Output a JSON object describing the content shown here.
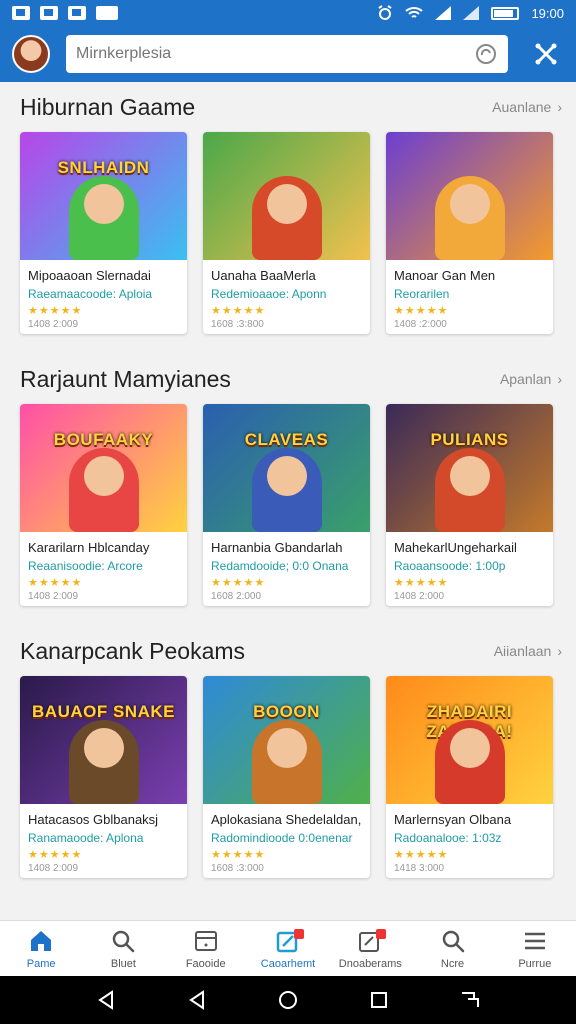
{
  "status_bar": {
    "time": "19:00"
  },
  "search": {
    "placeholder": "Mirnkerplesia"
  },
  "sections": [
    {
      "title": "Hiburnan Gaame",
      "see_all": "Auanlane",
      "cards": [
        {
          "banner": "SNLHAIDN",
          "name": "Mipoaaoan Slernadai",
          "subtitle": "Raeamaacoode: Aploia",
          "stars": "★★★★★",
          "meta": "1408 2:009",
          "bg": [
            "#b845e8",
            "#3ac0f0"
          ],
          "char": "#4bbf4b"
        },
        {
          "banner": "",
          "name": "Uanaha BaaMerla",
          "subtitle": "Redemioaaoe: Aponn",
          "stars": "★★★★★",
          "meta": "1608 :3:800",
          "bg": [
            "#4aa84a",
            "#f2c14e"
          ],
          "char": "#d64a2a"
        },
        {
          "banner": "",
          "name": "Manoar Gan Men",
          "subtitle": "Reorarilen",
          "stars": "★★★★★",
          "meta": "1408 :2:000",
          "bg": [
            "#6b3fd1",
            "#f59b2a"
          ],
          "char": "#f3a83a"
        }
      ]
    },
    {
      "title": "Rarjaunt Mamyianes",
      "see_all": "Apanlan",
      "cards": [
        {
          "banner": "BOUFAAKY",
          "name": "Kararilarn Hblcanday",
          "subtitle": "Reaanisoodie: Arcore",
          "stars": "★★★★★",
          "meta": "1408 2:009",
          "bg": [
            "#ff4fa8",
            "#ffd23f"
          ],
          "char": "#e84545"
        },
        {
          "banner": "CLAVEAS",
          "name": "Harnanbia Gbandarlah",
          "subtitle": "Redamdooide; 0:0 Onana",
          "stars": "★★★★★",
          "meta": "1608 2:000",
          "bg": [
            "#2a5fb0",
            "#3aa06a"
          ],
          "char": "#3b5bb8"
        },
        {
          "banner": "PULIANS",
          "name": "MahekarlUngeharkail",
          "subtitle": "Raoaansoode: 1:00p",
          "stars": "★★★★★",
          "meta": "1408 2:000",
          "bg": [
            "#3a2a58",
            "#c47a2a"
          ],
          "char": "#d24a2a"
        }
      ]
    },
    {
      "title": "Kanarpcank Peokams",
      "see_all": "Aiianlaan",
      "cards": [
        {
          "banner": "BAUAOF SNAKE",
          "name": "Hatacasos Gblbanaksj",
          "subtitle": "Ranamaoode: Aplona",
          "stars": "★★★★★",
          "meta": "1408 2:009",
          "bg": [
            "#2a1a4a",
            "#7a3fb0"
          ],
          "char": "#6b4a2a"
        },
        {
          "banner": "BOOON",
          "name": "Aplokasiana Shedelaldan,",
          "subtitle": "Radomindioode 0:0enenar",
          "stars": "★★★★★",
          "meta": "1608 :3:000",
          "bg": [
            "#2f8ad8",
            "#4fb04a"
          ],
          "char": "#c8742a"
        },
        {
          "banner": "ZHADAIRI ZARPIGA!",
          "name": "Marlernsyan Olbana",
          "subtitle": "Radoanalooe: 1:03z",
          "stars": "★★★★★",
          "meta": "1418 3:000",
          "bg": [
            "#ff8a1a",
            "#ffd23f"
          ],
          "char": "#d63a2a"
        }
      ]
    }
  ],
  "bottom_nav": [
    {
      "label": "Pame",
      "icon": "home-icon"
    },
    {
      "label": "Bluet",
      "icon": "search-icon"
    },
    {
      "label": "Faooide",
      "icon": "tablet-icon"
    },
    {
      "label": "Caoarhemt",
      "icon": "edit-icon"
    },
    {
      "label": "Dnoaberams",
      "icon": "notes-icon"
    },
    {
      "label": "Ncre",
      "icon": "search-icon"
    },
    {
      "label": "Purrue",
      "icon": "menu-icon"
    }
  ],
  "colors": {
    "primary": "#1e73c9",
    "star": "#f1b51c",
    "subtitle": "#1f9ca7"
  }
}
